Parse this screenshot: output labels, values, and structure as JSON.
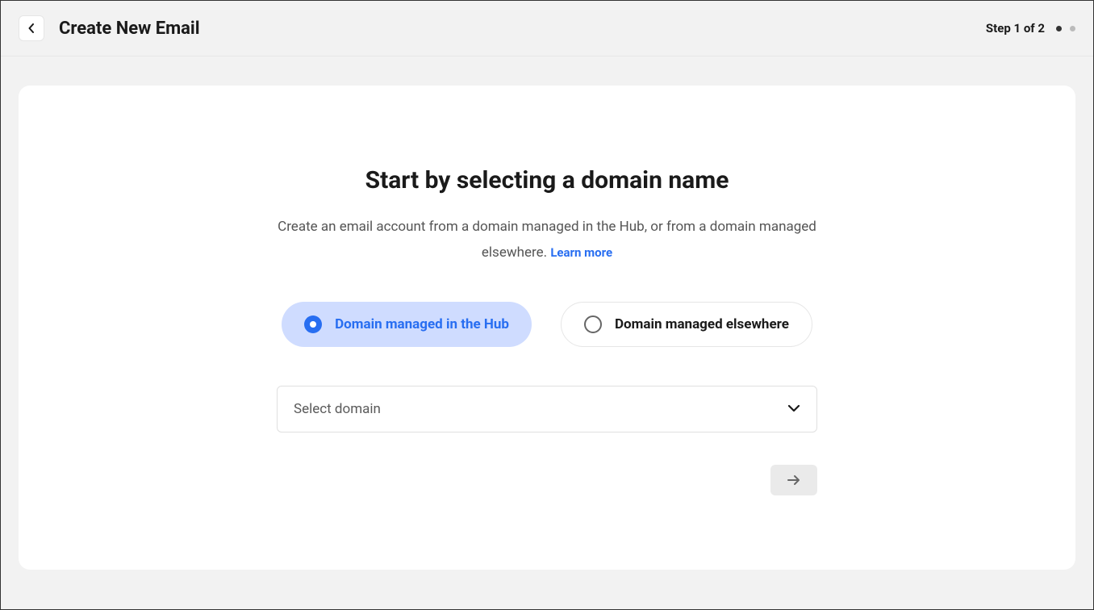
{
  "header": {
    "title": "Create New Email",
    "step_label": "Step 1 of 2"
  },
  "main": {
    "heading": "Start by selecting a domain name",
    "subtext_prefix": "Create an email account from a domain managed in the Hub, or from a domain managed elsewhere. ",
    "learn_more": "Learn more"
  },
  "options": {
    "hub": "Domain managed in the Hub",
    "elsewhere": "Domain managed elsewhere"
  },
  "select": {
    "placeholder": "Select domain"
  }
}
